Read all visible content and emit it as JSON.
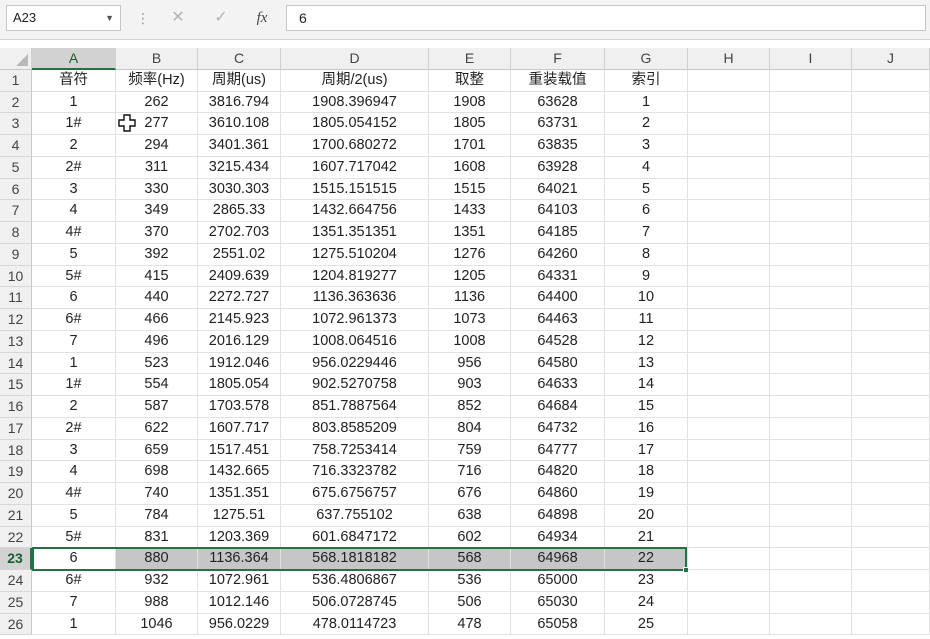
{
  "name_box": "A23",
  "formula_value": "6",
  "icons": {
    "cancel": "close-icon",
    "enter": "check-icon",
    "function": "fx-icon"
  },
  "function_label": "fx",
  "accent_color": "#217346",
  "columns": [
    "A",
    "B",
    "C",
    "D",
    "E",
    "F",
    "G",
    "H",
    "I",
    "J"
  ],
  "active_cell": "A23",
  "selected_row": 23,
  "rows": [
    {
      "n": "1",
      "cells": [
        "音符",
        "频率(Hz)",
        "周期(us)",
        "周期/2(us)",
        "取整",
        "重装载值",
        "索引"
      ]
    },
    {
      "n": "2",
      "cells": [
        "1",
        "262",
        "3816.794",
        "1908.396947",
        "1908",
        "63628",
        "1"
      ]
    },
    {
      "n": "3",
      "cells": [
        "1#",
        "277",
        "3610.108",
        "1805.054152",
        "1805",
        "63731",
        "2"
      ]
    },
    {
      "n": "4",
      "cells": [
        "2",
        "294",
        "3401.361",
        "1700.680272",
        "1701",
        "63835",
        "3"
      ]
    },
    {
      "n": "5",
      "cells": [
        "2#",
        "311",
        "3215.434",
        "1607.717042",
        "1608",
        "63928",
        "4"
      ]
    },
    {
      "n": "6",
      "cells": [
        "3",
        "330",
        "3030.303",
        "1515.151515",
        "1515",
        "64021",
        "5"
      ]
    },
    {
      "n": "7",
      "cells": [
        "4",
        "349",
        "2865.33",
        "1432.664756",
        "1433",
        "64103",
        "6"
      ]
    },
    {
      "n": "8",
      "cells": [
        "4#",
        "370",
        "2702.703",
        "1351.351351",
        "1351",
        "64185",
        "7"
      ]
    },
    {
      "n": "9",
      "cells": [
        "5",
        "392",
        "2551.02",
        "1275.510204",
        "1276",
        "64260",
        "8"
      ]
    },
    {
      "n": "10",
      "cells": [
        "5#",
        "415",
        "2409.639",
        "1204.819277",
        "1205",
        "64331",
        "9"
      ]
    },
    {
      "n": "11",
      "cells": [
        "6",
        "440",
        "2272.727",
        "1136.363636",
        "1136",
        "64400",
        "10"
      ]
    },
    {
      "n": "12",
      "cells": [
        "6#",
        "466",
        "2145.923",
        "1072.961373",
        "1073",
        "64463",
        "11"
      ]
    },
    {
      "n": "13",
      "cells": [
        "7",
        "496",
        "2016.129",
        "1008.064516",
        "1008",
        "64528",
        "12"
      ]
    },
    {
      "n": "14",
      "cells": [
        "1",
        "523",
        "1912.046",
        "956.0229446",
        "956",
        "64580",
        "13"
      ]
    },
    {
      "n": "15",
      "cells": [
        "1#",
        "554",
        "1805.054",
        "902.5270758",
        "903",
        "64633",
        "14"
      ]
    },
    {
      "n": "16",
      "cells": [
        "2",
        "587",
        "1703.578",
        "851.7887564",
        "852",
        "64684",
        "15"
      ]
    },
    {
      "n": "17",
      "cells": [
        "2#",
        "622",
        "1607.717",
        "803.8585209",
        "804",
        "64732",
        "16"
      ]
    },
    {
      "n": "18",
      "cells": [
        "3",
        "659",
        "1517.451",
        "758.7253414",
        "759",
        "64777",
        "17"
      ]
    },
    {
      "n": "19",
      "cells": [
        "4",
        "698",
        "1432.665",
        "716.3323782",
        "716",
        "64820",
        "18"
      ]
    },
    {
      "n": "20",
      "cells": [
        "4#",
        "740",
        "1351.351",
        "675.6756757",
        "676",
        "64860",
        "19"
      ]
    },
    {
      "n": "21",
      "cells": [
        "5",
        "784",
        "1275.51",
        "637.755102",
        "638",
        "64898",
        "20"
      ]
    },
    {
      "n": "22",
      "cells": [
        "5#",
        "831",
        "1203.369",
        "601.6847172",
        "602",
        "64934",
        "21"
      ]
    },
    {
      "n": "23",
      "cells": [
        "6",
        "880",
        "1136.364",
        "568.1818182",
        "568",
        "64968",
        "22"
      ]
    },
    {
      "n": "24",
      "cells": [
        "6#",
        "932",
        "1072.961",
        "536.4806867",
        "536",
        "65000",
        "23"
      ]
    },
    {
      "n": "25",
      "cells": [
        "7",
        "988",
        "1012.146",
        "506.0728745",
        "506",
        "65030",
        "24"
      ]
    },
    {
      "n": "26",
      "cells": [
        "1",
        "1046",
        "956.0229",
        "478.0114723",
        "478",
        "65058",
        "25"
      ]
    }
  ]
}
